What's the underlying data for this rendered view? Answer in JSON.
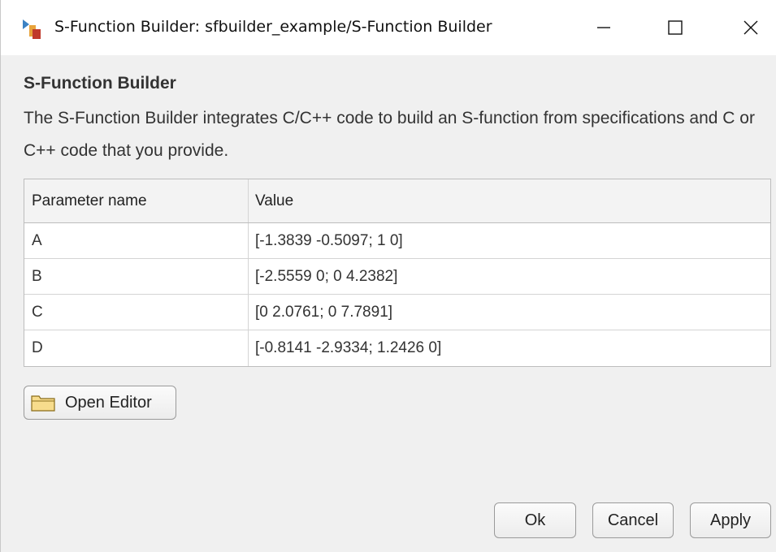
{
  "window": {
    "title": "S-Function Builder: sfbuilder_example/S-Function Builder"
  },
  "dialog": {
    "heading": "S-Function Builder",
    "description": "The S-Function Builder integrates C/C++ code to build an S-function from specifications and C or C++ code that you provide."
  },
  "table": {
    "headers": [
      "Parameter name",
      "Value"
    ],
    "rows": [
      {
        "name": "A",
        "value": "[-1.3839 -0.5097; 1 0]"
      },
      {
        "name": "B",
        "value": "[-2.5559 0; 0 4.2382]"
      },
      {
        "name": "C",
        "value": "[0 2.0761; 0 7.7891]"
      },
      {
        "name": "D",
        "value": "[-0.8141 -2.9334; 1.2426 0]"
      }
    ]
  },
  "buttons": {
    "open_editor": "Open Editor",
    "ok": "Ok",
    "cancel": "Cancel",
    "apply": "Apply"
  },
  "icons": {
    "app": "simulink-block-icon",
    "minimize": "minimize-icon",
    "maximize": "maximize-icon",
    "close": "close-icon",
    "folder": "folder-icon"
  }
}
